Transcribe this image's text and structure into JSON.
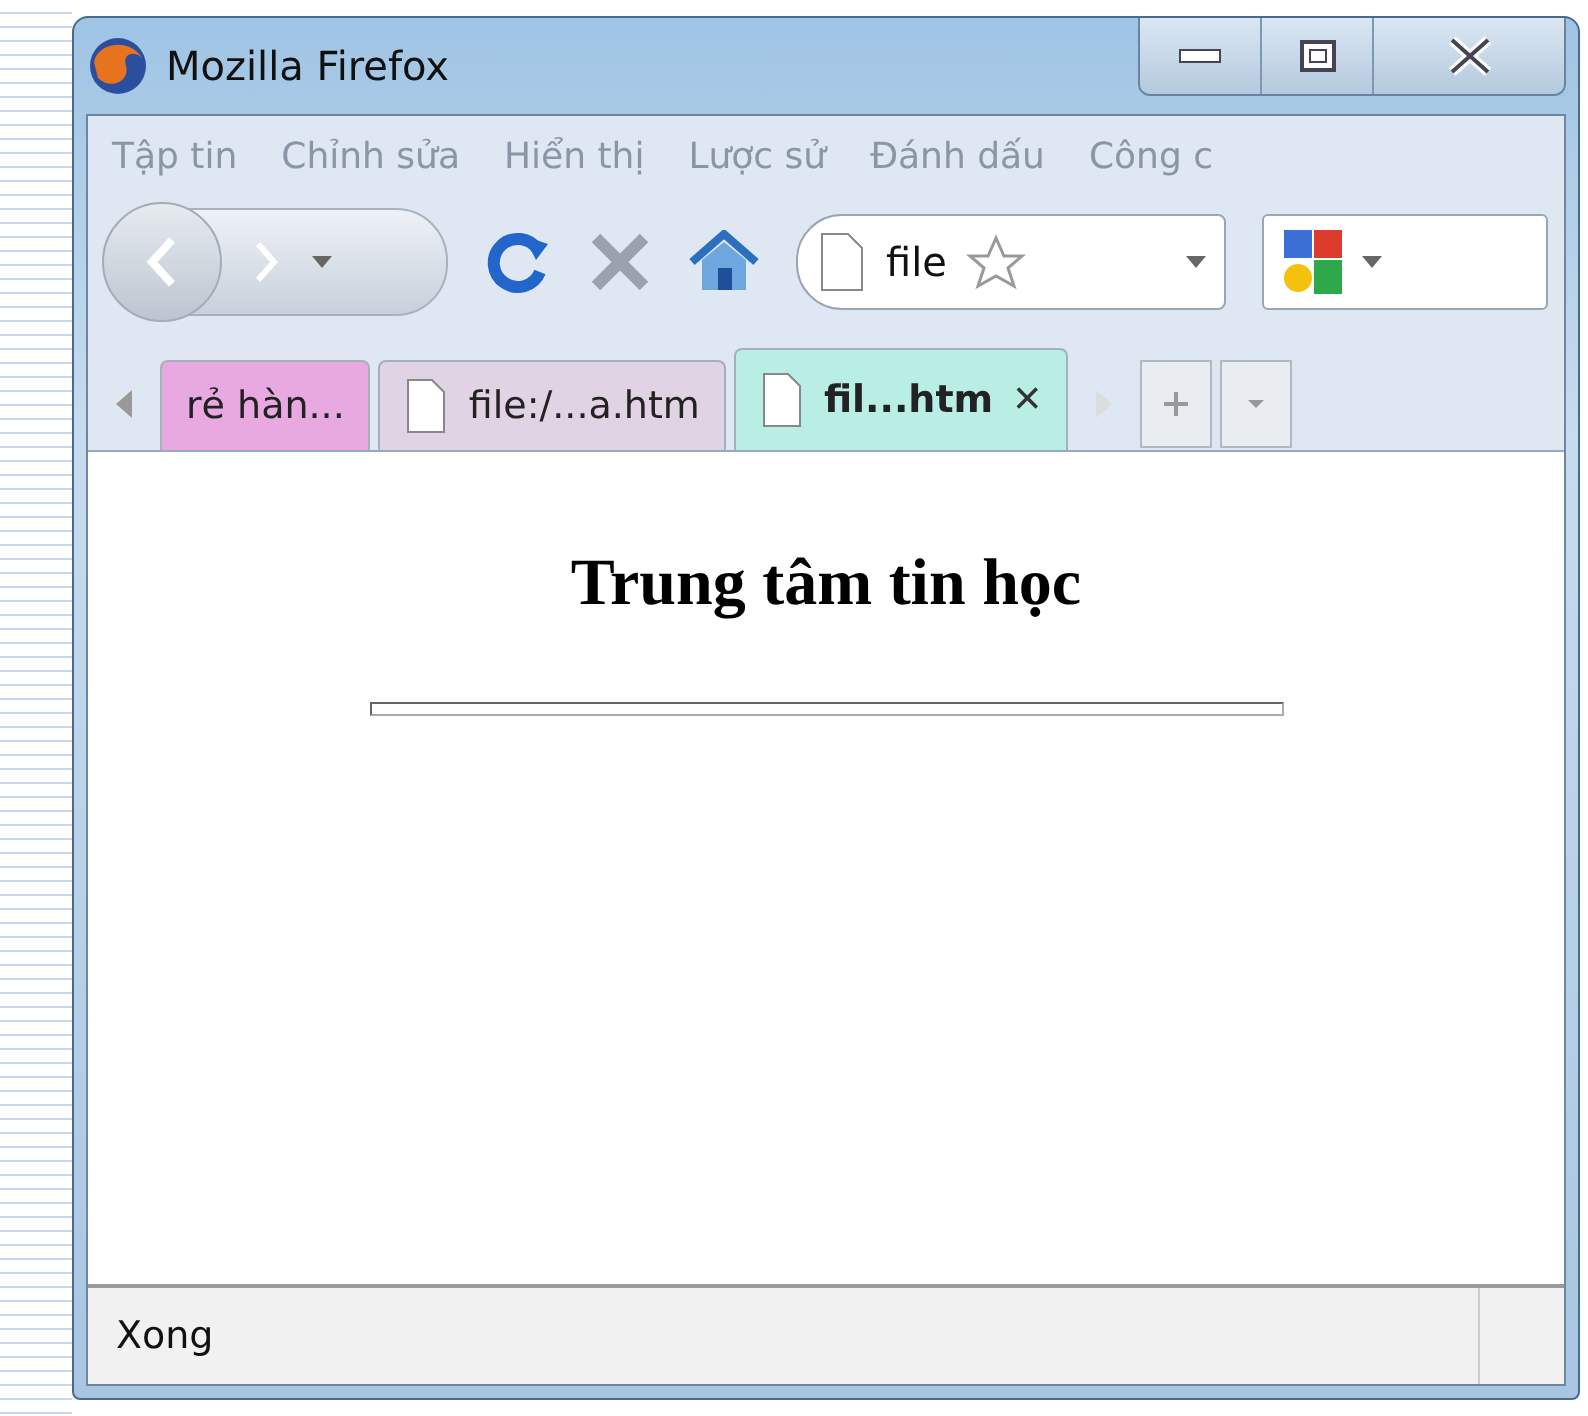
{
  "window": {
    "title": "Mozilla Firefox"
  },
  "menu": [
    "Tập tin",
    "Chỉnh sửa",
    "Hiển thị",
    "Lược sử",
    "Đánh dấu",
    "Công c"
  ],
  "url_field": {
    "value": "file"
  },
  "tabs": [
    {
      "label": "rẻ hàn...",
      "selected": false,
      "color": "#e8a8e0",
      "closable": false
    },
    {
      "label": "file:/...a.htm",
      "selected": false,
      "color": "#e0d4e4",
      "closable": false
    },
    {
      "label": "fil...htm",
      "selected": true,
      "color": "#b8eee4",
      "closable": true,
      "close": "×"
    }
  ],
  "page": {
    "heading": "Trung tâm tin học"
  },
  "status_bar": {
    "text": "Xong"
  }
}
